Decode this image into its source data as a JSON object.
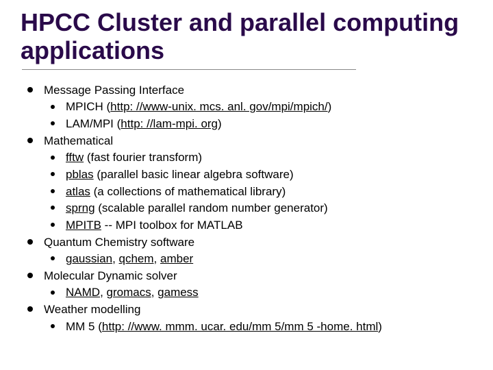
{
  "title": "HPCC Cluster and parallel computing applications",
  "items": [
    {
      "label": "Message Passing Interface",
      "sub": [
        {
          "html": "MPICH (<span class='u'>http: //www-unix. mcs. anl. gov/mpi/mpich/</span>)"
        },
        {
          "html": "LAM/MPI (<span class='u'>http: //lam-mpi. org</span>)"
        }
      ]
    },
    {
      "label": "Mathematical",
      "sub": [
        {
          "html": "<span class='u'>fftw</span>  (fast fourier transform)"
        },
        {
          "html": "<span class='u'>pblas</span> (parallel basic linear algebra software)"
        },
        {
          "html": "<span class='u'>atlas</span> (a collections of mathematical library)"
        },
        {
          "html": "<span class='u'>sprng</span> (scalable parallel random number generator)"
        },
        {
          "html": "<span class='u'>MPITB</span> -- MPI toolbox for MATLAB"
        }
      ]
    },
    {
      "label": "Quantum Chemistry software",
      "sub": [
        {
          "html": "<span class='u'>gaussian</span>, <span class='u'>qchem</span>, <span class='u'>amber</span>"
        }
      ]
    },
    {
      "label": "Molecular Dynamic solver",
      "sub": [
        {
          "html": "<span class='u'>NAMD</span>, <span class='u'>gromacs</span>, <span class='u'>gamess</span>"
        }
      ]
    },
    {
      "label": "Weather modelling",
      "sub": [
        {
          "html": "MM 5 (<span class='u'>http: //www. mmm. ucar. edu/mm 5/mm 5 -home. html</span>)"
        }
      ]
    }
  ]
}
